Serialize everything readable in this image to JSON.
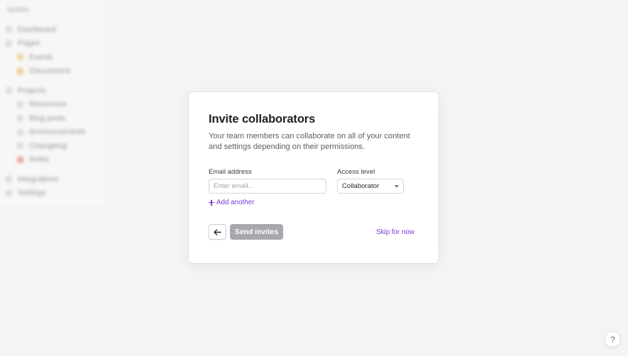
{
  "background": {
    "sidebar": {
      "workspace": "Notion",
      "items": [
        {
          "label": "Dashboard",
          "icon": "home-icon",
          "color": "gray",
          "sub": false
        },
        {
          "label": "Pages",
          "icon": "page-icon",
          "color": "gray",
          "sub": false
        },
        {
          "label": "Events",
          "icon": "star-icon",
          "color": "yellow",
          "sub": true
        },
        {
          "label": "Discussions",
          "icon": "sun-icon",
          "color": "orange",
          "sub": true
        },
        {
          "label": "Projects",
          "icon": "folder-icon",
          "color": "gray",
          "sub": false,
          "gap": true
        },
        {
          "label": "Resources",
          "icon": "table-icon",
          "color": "gray",
          "sub": true
        },
        {
          "label": "Blog posts",
          "icon": "edit-icon",
          "color": "gray",
          "sub": true
        },
        {
          "label": "Announcements",
          "icon": "doc-icon",
          "color": "gray",
          "sub": true
        },
        {
          "label": "Changelog",
          "icon": "list-icon",
          "color": "gray",
          "sub": true
        },
        {
          "label": "Roles",
          "icon": "heart-icon",
          "color": "red",
          "sub": true
        },
        {
          "label": "Integrations",
          "icon": "plug-icon",
          "color": "gray",
          "sub": false,
          "gap": true
        },
        {
          "label": "Settings",
          "icon": "gear-icon",
          "color": "gray",
          "sub": false
        }
      ]
    }
  },
  "modal": {
    "title": "Invite collaborators",
    "description": "Your team members can collaborate on all of your content and settings depending on their permissions.",
    "email": {
      "label": "Email address",
      "placeholder": "Enter email...",
      "value": ""
    },
    "access": {
      "label": "Access level",
      "value": "Collaborator"
    },
    "add_another": "Add another",
    "send_button": "Send invites",
    "skip_link": "Skip for now"
  },
  "help": {
    "label": "?"
  },
  "colors": {
    "accent": "#7b3ad6",
    "disabled_button": "#a7a7ad",
    "page_background": "#f4f4f5"
  }
}
